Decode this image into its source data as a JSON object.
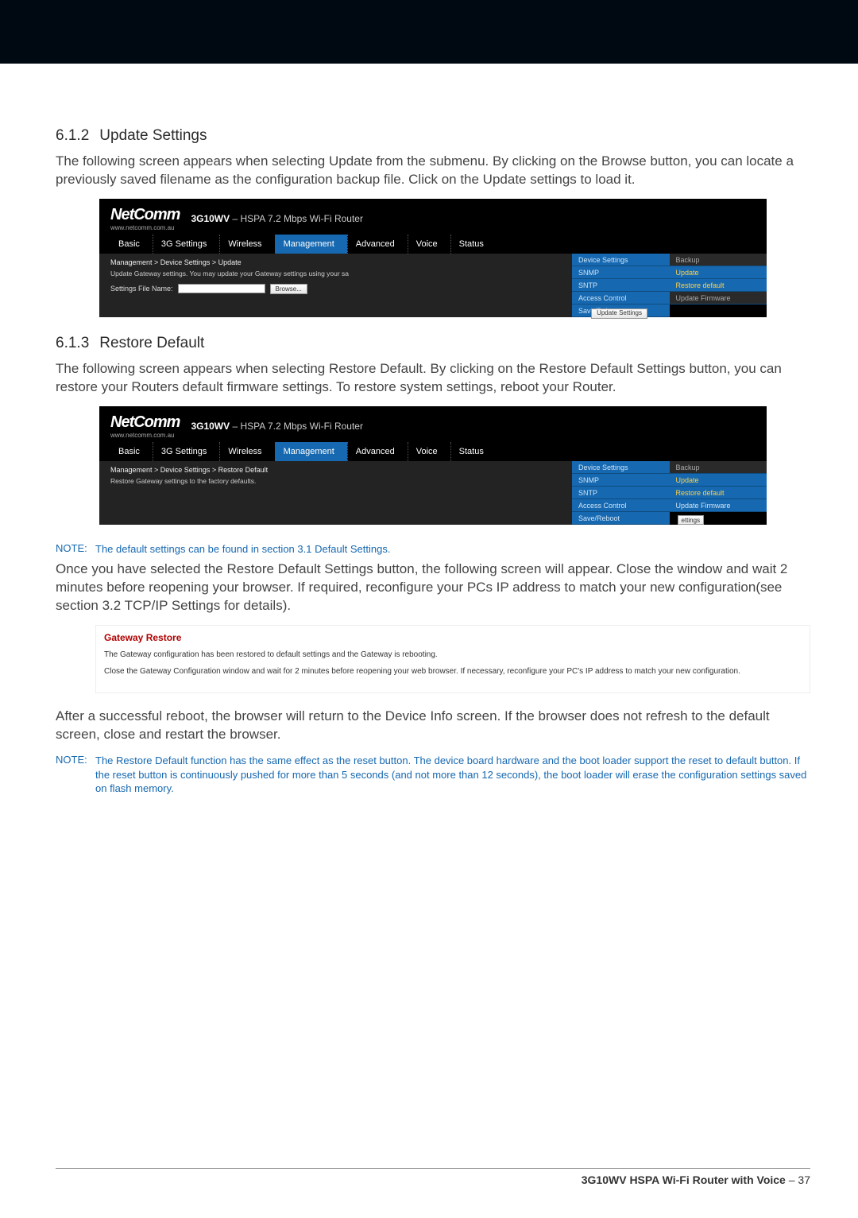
{
  "sections": {
    "s612": {
      "num": "6.1.2",
      "title": "Update Settings"
    },
    "s613": {
      "num": "6.1.3",
      "title": "Restore Default"
    }
  },
  "paras": {
    "p1": "The following screen appears when selecting Update from the submenu. By clicking on the Browse button, you can locate a previously saved filename as the configuration backup file. Click on the Update settings to load it.",
    "p2": "The following screen appears when selecting Restore Default. By clicking on the Restore Default Settings button, you can restore your Routers default firmware settings. To restore system settings, reboot your Router.",
    "p3": "Once you have selected the Restore Default Settings button, the following screen will appear. Close the window and wait 2 minutes before reopening your browser. If required, reconfigure your PCs IP address to match your new configuration(see section 3.2 TCP/IP Settings for details).",
    "p4": "After a successful reboot, the browser will return to the Device Info screen. If the browser does not refresh to the default screen, close and restart the browser."
  },
  "router": {
    "brand": "NetComm",
    "sublogo": "www.netcomm.com.au",
    "model_bold": "3G10WV",
    "model_rest": " – HSPA 7.2 Mbps Wi-Fi Router",
    "tabs": [
      "Basic",
      "3G Settings",
      "Wireless",
      "Management",
      "Advanced",
      "Voice",
      "Status"
    ],
    "update": {
      "breadcrumb": "Management > Device Settings > Update",
      "help": "Update Gateway settings. You may update your Gateway settings using your sa",
      "field_label": "Settings File Name:",
      "browse": "Browse...",
      "update_btn": "Update Settings",
      "submenu_left": [
        "Device Settings",
        "SNMP",
        "SNTP",
        "Access Control",
        "Save/Reboot"
      ],
      "submenu_right": [
        "Backup",
        "Update",
        "Restore default",
        "Update Firmware"
      ]
    },
    "restore": {
      "breadcrumb": "Management > Device Settings > Restore Default",
      "help": "Restore Gateway settings to the factory defaults.",
      "submenu_left": [
        "Device Settings",
        "SNMP",
        "SNTP",
        "Access Control",
        "Save/Reboot"
      ],
      "submenu_right": [
        "Backup",
        "Update",
        "Restore default",
        "Update Firmware"
      ],
      "ettings": "ettings"
    }
  },
  "notes": {
    "label": "NOTE:",
    "n1": "The default settings can be found in section 3.1 Default Settings.",
    "n2": "The Restore Default function has the same effect as the reset button. The device board hardware and the boot loader support the reset to default button. If the reset button is continuously pushed for more than 5 seconds (and not more than 12 seconds), the boot loader will erase the configuration settings saved on flash memory."
  },
  "gateway": {
    "title": "Gateway Restore",
    "line1": "The Gateway configuration has been restored to default settings and the Gateway is rebooting.",
    "line2": "Close the Gateway Configuration window and wait for 2 minutes before reopening your web browser. If necessary, reconfigure your PC's IP address to match your new configuration."
  },
  "footer": {
    "product": "3G10WV HSPA Wi-Fi Router with Voice",
    "sep": " – ",
    "page": "37"
  }
}
